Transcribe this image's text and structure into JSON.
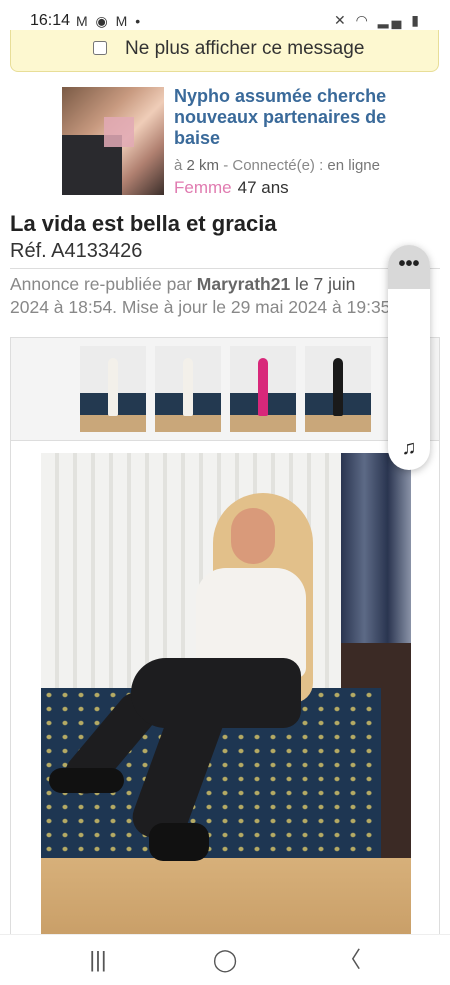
{
  "status_bar": {
    "time": "16:14",
    "left_icons": "M ◉ M •",
    "right_icons": "✕ ◠ ▂▄ ▮"
  },
  "notice": {
    "checkbox_label": "Ne plus afficher ce message",
    "checked": false
  },
  "profile": {
    "title": "Nypho assumée cherche nouveaux partenaires de baise",
    "distance_prefix": "à ",
    "distance": "2 km",
    "status_prefix": " - Connecté(e) : ",
    "status": "en ligne",
    "gender": "Femme",
    "age": "47 ans"
  },
  "ad": {
    "title": "La vida est bella et gracia",
    "ref": "Réf. A4133426",
    "meta_line1_prefix": "Annonce re-publiée par ",
    "author": "Maryrath21",
    "meta_line1_suffix": " le 7 juin",
    "meta_line2": "2024 à 18:54. Mise à jour le 29 mai 2024 à 19:35."
  },
  "gallery": {
    "thumbnail_count": 4,
    "active_index": 0,
    "thumb_figure_colors": [
      "#f3f0ea",
      "#f3f0ea",
      "#d8287a",
      "#1a1a1a"
    ]
  },
  "floating_panel": {
    "more_label": "•••",
    "audio_icon": "♫"
  },
  "navbar": {
    "recents_icon": "|||",
    "home_icon": "◯",
    "back_icon": "〈"
  }
}
